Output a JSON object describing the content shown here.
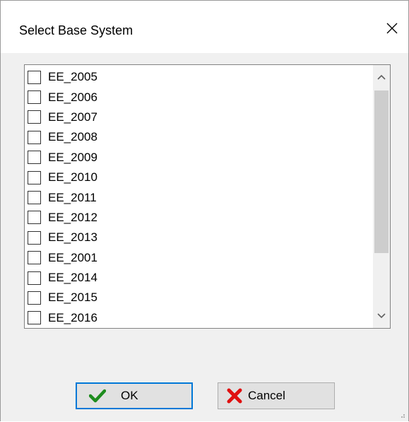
{
  "dialog": {
    "title": "Select Base System"
  },
  "list": {
    "items": [
      {
        "label": "EE_2005",
        "checked": false
      },
      {
        "label": "EE_2006",
        "checked": false
      },
      {
        "label": "EE_2007",
        "checked": false
      },
      {
        "label": "EE_2008",
        "checked": false
      },
      {
        "label": "EE_2009",
        "checked": false
      },
      {
        "label": "EE_2010",
        "checked": false
      },
      {
        "label": "EE_2011",
        "checked": false
      },
      {
        "label": "EE_2012",
        "checked": false
      },
      {
        "label": "EE_2013",
        "checked": false
      },
      {
        "label": "EE_2001",
        "checked": false
      },
      {
        "label": "EE_2014",
        "checked": false
      },
      {
        "label": "EE_2015",
        "checked": false
      },
      {
        "label": "EE_2016",
        "checked": false
      }
    ]
  },
  "buttons": {
    "ok_label": "OK",
    "cancel_label": "Cancel"
  },
  "icons": {
    "close": "close-icon",
    "scroll_up": "chevron-up-icon",
    "scroll_down": "chevron-down-icon",
    "ok": "checkmark-icon",
    "cancel": "red-x-icon"
  },
  "colors": {
    "focus_border": "#0078d7",
    "ok_icon": "#1e8c1e",
    "cancel_icon": "#e01010"
  }
}
